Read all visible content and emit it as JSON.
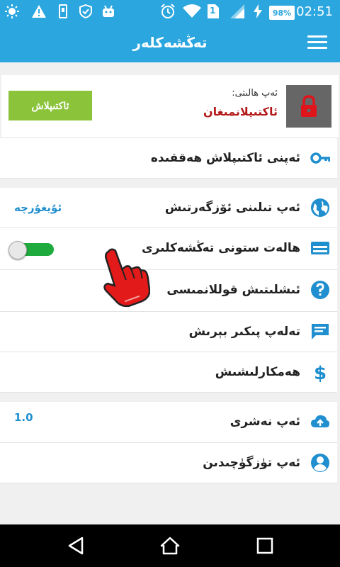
{
  "status_bar": {
    "time": "02:51",
    "battery": "98%",
    "sim_slot": "1",
    "icons_left": [
      "brightness-icon",
      "warning-icon",
      "device-icon",
      "shield-check-icon",
      "android-icon"
    ],
    "icons_right": [
      "alarm-icon",
      "wifi-icon",
      "sim-icon",
      "signal-icon",
      "charging-icon"
    ]
  },
  "app_bar": {
    "title": "تەڭشەكلەر",
    "menu_icon": "hamburger-menu-icon"
  },
  "activation": {
    "status_title": "ئەپ ھالىتى:",
    "status_value": "ئاكتىپلانمىغان",
    "button_label": "ئاكتىپلاش",
    "lock_icon": "lock-icon"
  },
  "about_activation": {
    "label": "ئەپنى ئاكتىپلاش ھەققىدە",
    "icon": "key-icon"
  },
  "settings": {
    "language": {
      "label": "ئەپ تىلىنى ئۆزگەرتىش",
      "value": "ئۇيغۇرچە",
      "icon": "globe-icon"
    },
    "status_column": {
      "label": "ھالەت ستونى تەڭشەكلىرى",
      "enabled": true,
      "icon": "card-icon"
    },
    "instructions": {
      "label": "ئىشلىتىش قوللانمىسى",
      "icon": "help-icon"
    },
    "feedback": {
      "label": "تەلەپ پىكىر بېرىش",
      "icon": "chat-icon"
    },
    "cooperation": {
      "label": "ھەمكارلىشىش",
      "icon": "dollar-icon"
    }
  },
  "info": {
    "version": {
      "label": "ئەپ نەشرى",
      "value": "1.0",
      "icon": "cloud-upload-icon"
    },
    "developer": {
      "label": "ئەپ تۈزگۈچىدىن",
      "icon": "account-icon"
    }
  },
  "colors": {
    "primary": "#2ba6df",
    "accent_green": "#8bc33a",
    "toggle_green": "#1eaa3c",
    "error_red": "#b41b1b",
    "icon_blue": "#1f8fcf"
  }
}
